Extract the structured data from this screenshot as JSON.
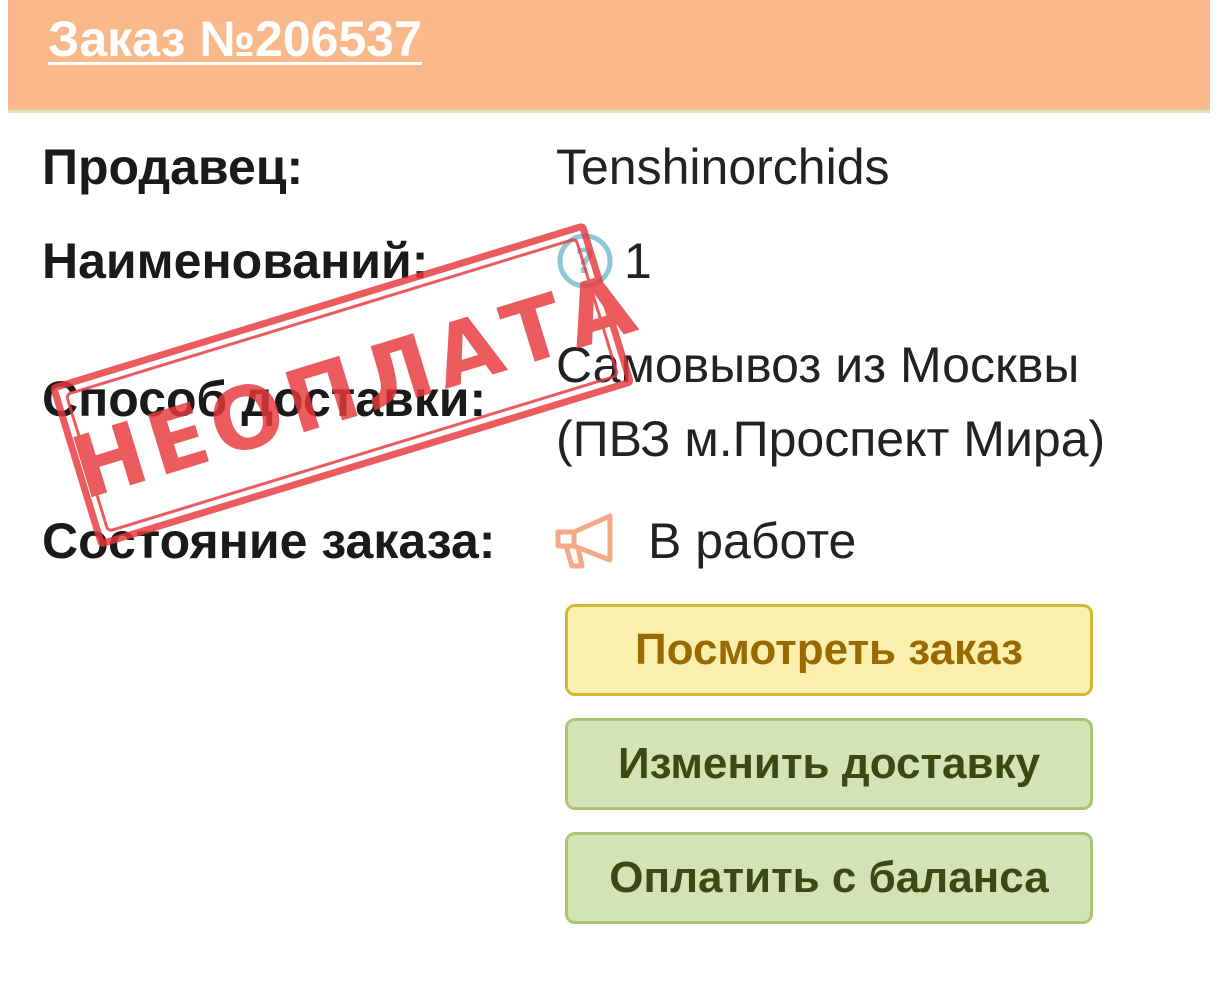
{
  "header": {
    "order_title": "Заказ №206537"
  },
  "details": {
    "seller_label": "Продавец:",
    "seller_value": "Tenshinorchids",
    "items_label": "Наименований:",
    "items_value": "1",
    "delivery_label": "Способ доставки:",
    "delivery_value": "Самовывоз из Москвы (ПВЗ м.Проспект Мира)",
    "status_label": "Состояние заказа:",
    "status_value": "В работе"
  },
  "stamp": {
    "text": "НЕОПЛАТА"
  },
  "buttons": {
    "view_order": "Посмотреть заказ",
    "change_delivery": "Изменить доставку",
    "pay_from_balance": "Оплатить с баланса"
  },
  "icons": {
    "help": "question-circle-icon",
    "status": "megaphone-icon"
  },
  "colors": {
    "header_bg": "#f9b98b",
    "stamp": "#e8393b",
    "view_button_bg": "#fbefae",
    "green_button_bg": "#d3e3b5"
  }
}
